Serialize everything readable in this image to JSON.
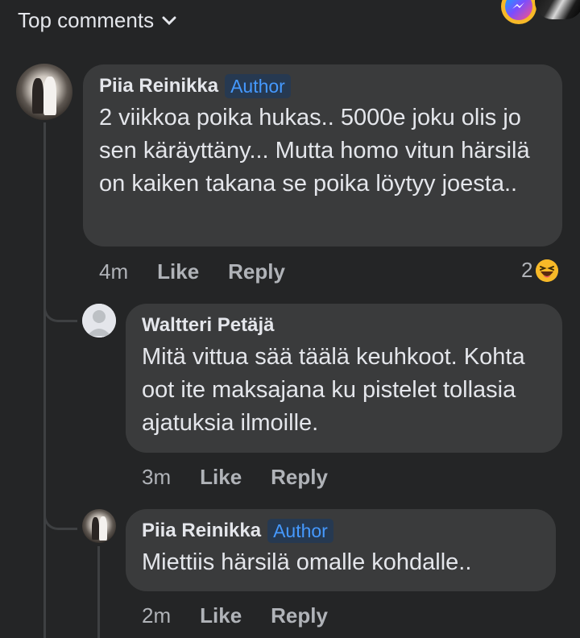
{
  "header": {
    "sort_label": "Top comments"
  },
  "comments": [
    {
      "author": "Piia Reinikka",
      "badge": "Author",
      "text": "2 viikkoa poika hukas.. 5000e joku olis jo sen käräyttäny... Mutta homo vitun härsilä on kaiken takana se poika löytyy joesta..",
      "time": "4m",
      "like": "Like",
      "reply": "Reply",
      "reaction_count": "2"
    },
    {
      "author": "Waltteri Petäjä",
      "text": "Mitä vittua sää täälä keuhkoot. Kohta oot ite maksajana ku pistelet tollasia ajatuksia ilmoille.",
      "time": "3m",
      "like": "Like",
      "reply": "Reply"
    },
    {
      "author": "Piia Reinikka",
      "badge": "Author",
      "text": "Miettiis härsilä omalle kohdalle..",
      "time": "2m",
      "like": "Like",
      "reply": "Reply"
    }
  ],
  "colors": {
    "background": "#242526",
    "bubble": "#3a3b3c",
    "author_badge": "#4599ff",
    "secondary_text": "#b0b3b8"
  },
  "icons": {
    "sort": "chevron-down-icon",
    "messenger": "messenger-icon",
    "reaction": "haha-reaction-icon"
  }
}
